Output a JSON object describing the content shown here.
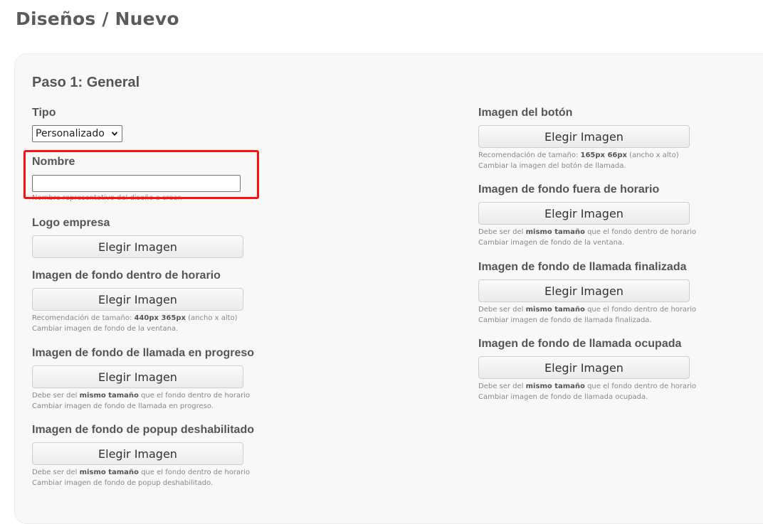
{
  "header": {
    "title": "Diseños / Nuevo"
  },
  "step": {
    "title": "Paso 1: General"
  },
  "tipo": {
    "label": "Tipo",
    "selected": "Personalizado"
  },
  "nombre": {
    "label": "Nombre",
    "value": "",
    "hint": "Nombre representativo del diseño a crear."
  },
  "button_label": "Elegir Imagen",
  "left_fields": [
    {
      "label": "Logo empresa"
    },
    {
      "label": "Imagen de fondo dentro de horario",
      "hint1_pre": "Recomendación de tamaño: ",
      "hint1_bold": "440px 365px",
      "hint1_post": " (ancho x alto)",
      "hint2": "Cambiar imagen de fondo de la ventana."
    },
    {
      "label": "Imagen de fondo de llamada en progreso",
      "hint1_pre": "Debe ser del ",
      "hint1_bold": "mismo tamaño",
      "hint1_post": " que el fondo dentro de horario",
      "hint2": "Cambiar imagen de fondo de llamada en progreso."
    },
    {
      "label": "Imagen de fondo de popup deshabilitado",
      "hint1_pre": "Debe ser del ",
      "hint1_bold": "mismo tamaño",
      "hint1_post": " que el fondo dentro de horario",
      "hint2": "Cambiar imagen de fondo de popup deshabilitado."
    }
  ],
  "right_fields": [
    {
      "label": "Imagen del botón",
      "hint1_pre": "Recomendación de tamaño: ",
      "hint1_bold": "165px 66px",
      "hint1_post": " (ancho x alto)",
      "hint2": "Cambiar la imagen del botón de llamada."
    },
    {
      "label": "Imagen de fondo fuera de horario",
      "hint1_pre": "Debe ser del ",
      "hint1_bold": "mismo tamaño",
      "hint1_post": " que el fondo dentro de horario",
      "hint2": "Cambiar imagen de fondo de la ventana."
    },
    {
      "label": "Imagen de fondo de llamada finalizada",
      "hint1_pre": "Debe ser del ",
      "hint1_bold": "mismo tamaño",
      "hint1_post": " que el fondo dentro de horario",
      "hint2": "Cambiar imagen de fondo de llamada finalizada."
    },
    {
      "label": "Imagen de fondo de llamada ocupada",
      "hint1_pre": "Debe ser del ",
      "hint1_bold": "mismo tamaño",
      "hint1_post": " que el fondo dentro de horario",
      "hint2": "Cambiar imagen de fondo de llamada ocupada."
    }
  ],
  "colors": {
    "highlight": "#ff1010",
    "card_background": "#f8f8f8"
  }
}
